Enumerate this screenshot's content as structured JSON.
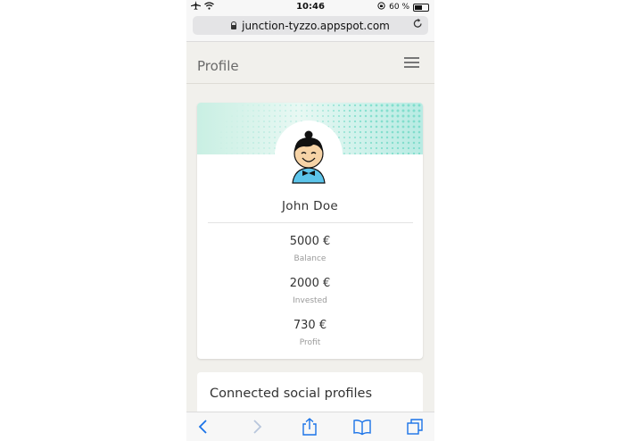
{
  "status_bar": {
    "time": "10:46",
    "battery": "60 %",
    "battery_level": 0.6
  },
  "browser": {
    "url": "junction-tyzzo.appspot.com"
  },
  "header": {
    "title": "Profile"
  },
  "profile": {
    "name": "John Doe",
    "stats": [
      {
        "value": "5000 €",
        "label": "Balance"
      },
      {
        "value": "2000 €",
        "label": "Invested"
      },
      {
        "value": "730 €",
        "label": "Profit"
      }
    ]
  },
  "social": {
    "title": "Connected social profiles"
  },
  "colors": {
    "accent": "#1a73e8",
    "banner": "#4fd1b8"
  }
}
